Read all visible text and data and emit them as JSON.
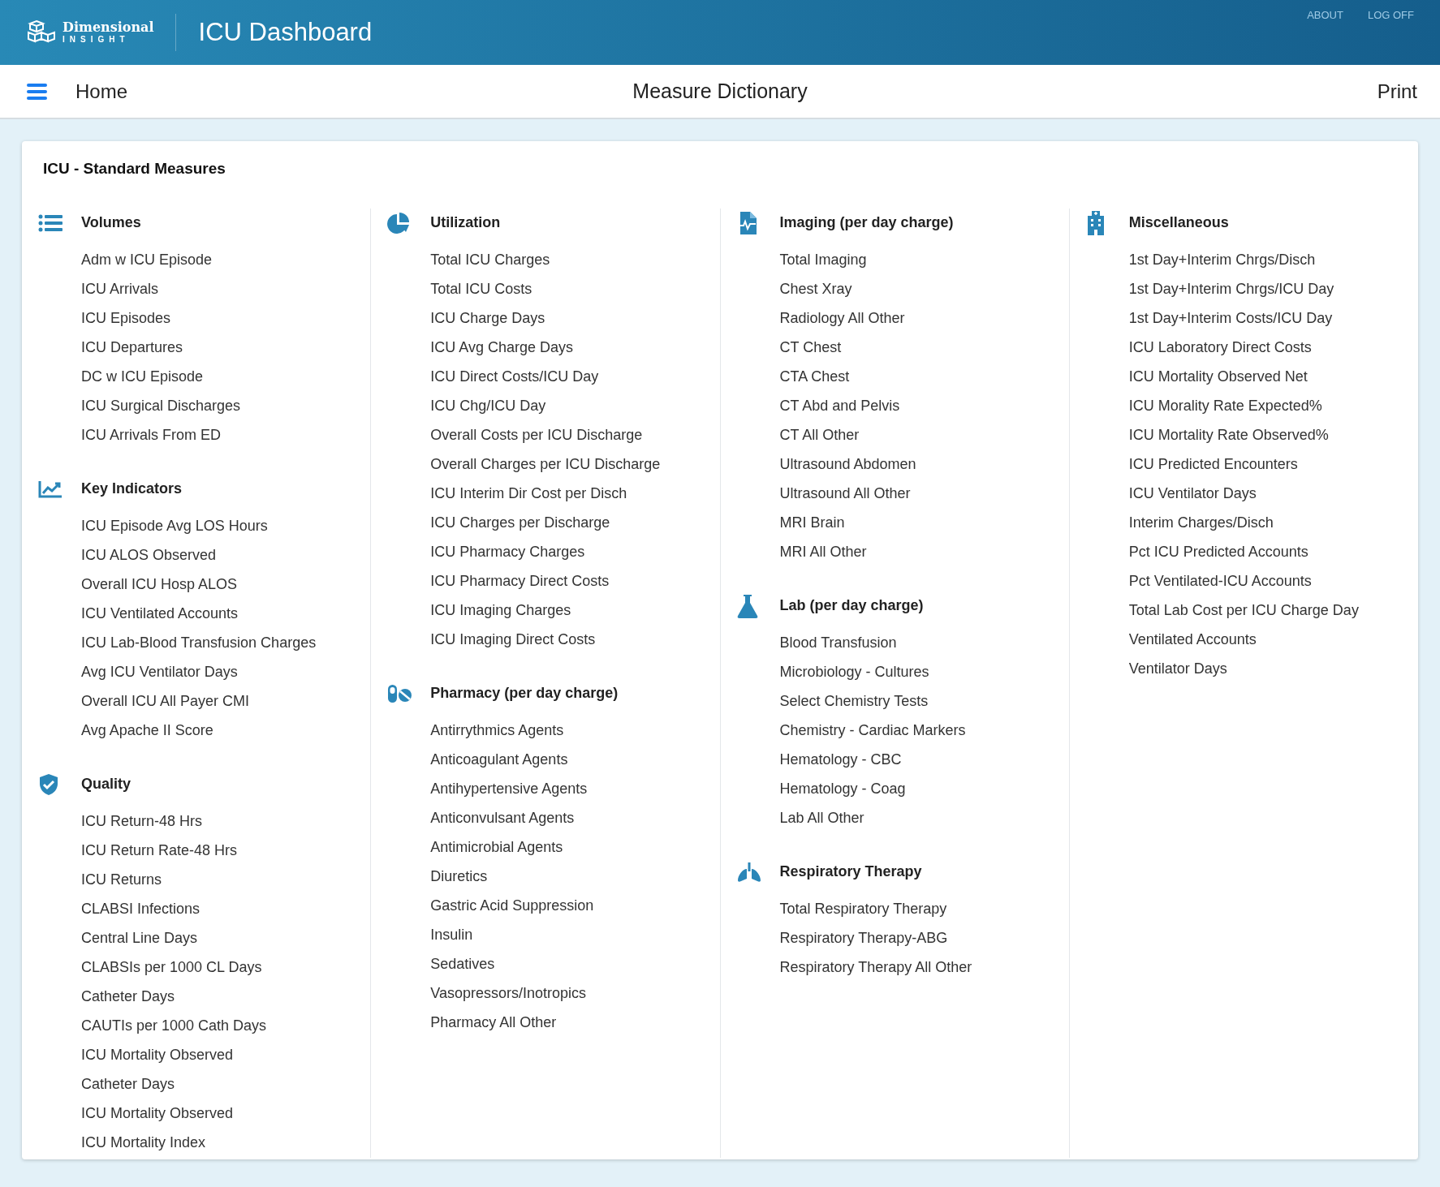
{
  "header": {
    "logo_top": "Dimensional",
    "logo_bottom": "INSIGHT",
    "title": "ICU Dashboard",
    "links": [
      "ABOUT",
      "LOG OFF"
    ]
  },
  "nav": {
    "home": "Home",
    "title": "Measure Dictionary",
    "print": "Print"
  },
  "card": {
    "title": "ICU - Standard Measures",
    "columns": [
      [
        {
          "kind": "list",
          "title": "Volumes",
          "items": [
            "Adm w ICU Episode",
            "ICU Arrivals",
            "ICU Episodes",
            "ICU Departures",
            "DC w ICU Episode",
            "ICU Surgical Discharges",
            "ICU Arrivals From ED"
          ]
        },
        {
          "kind": "chart",
          "title": "Key Indicators",
          "items": [
            "ICU Episode Avg LOS Hours",
            "ICU ALOS Observed",
            "Overall ICU Hosp ALOS",
            "ICU Ventilated Accounts",
            "ICU Lab-Blood Transfusion Charges",
            "Avg ICU Ventilator Days",
            "Overall ICU All Payer CMI",
            "Avg Apache II Score"
          ]
        },
        {
          "kind": "shield",
          "title": "Quality",
          "items": [
            "ICU Return-48 Hrs",
            "ICU Return Rate-48 Hrs",
            "ICU Returns",
            "CLABSI Infections",
            "Central Line Days",
            "CLABSIs per 1000 CL Days",
            "Catheter Days",
            "CAUTIs per 1000 Cath Days",
            "ICU Mortality Observed",
            "Catheter Days",
            "ICU Mortality Observed",
            "ICU Mortality Index"
          ]
        }
      ],
      [
        {
          "kind": "pie",
          "title": "Utilization",
          "items": [
            "Total ICU Charges",
            "Total ICU Costs",
            "ICU Charge Days",
            "ICU Avg Charge Days",
            "ICU Direct Costs/ICU Day",
            "ICU Chg/ICU Day",
            "Overall Costs per ICU Discharge",
            "Overall Charges per ICU Discharge",
            "ICU Interim Dir Cost per Disch",
            "ICU Charges per Discharge",
            "ICU Pharmacy Charges",
            "ICU Pharmacy Direct Costs",
            "ICU Imaging Charges",
            "ICU Imaging Direct Costs"
          ]
        },
        {
          "kind": "pills",
          "title": "Pharmacy (per day charge)",
          "items": [
            "Antirrythmics Agents",
            "Anticoagulant Agents",
            "Antihypertensive Agents",
            "Anticonvulsant Agents",
            "Antimicrobial Agents",
            "Diuretics",
            "Gastric Acid Suppression",
            "Insulin",
            "Sedatives",
            "Vasopressors/Inotropics",
            "Pharmacy All Other"
          ]
        }
      ],
      [
        {
          "kind": "file",
          "title": "Imaging (per day charge)",
          "items": [
            "Total Imaging",
            "Chest Xray",
            "Radiology All Other",
            "CT Chest",
            "CTA Chest",
            "CT Abd and Pelvis",
            "CT All Other",
            "Ultrasound Abdomen",
            "Ultrasound All Other",
            "MRI Brain",
            "MRI All Other"
          ]
        },
        {
          "kind": "flask",
          "title": "Lab (per day charge)",
          "items": [
            "Blood Transfusion",
            "Microbiology - Cultures",
            "Select Chemistry Tests",
            "Chemistry - Cardiac Markers",
            "Hematology - CBC",
            "Hematology - Coag",
            "Lab All Other"
          ]
        },
        {
          "kind": "lungs",
          "title": "Respiratory Therapy",
          "items": [
            "Total Respiratory Therapy",
            "Respiratory Therapy-ABG",
            "Respiratory Therapy All Other"
          ]
        }
      ],
      [
        {
          "kind": "building",
          "title": "Miscellaneous",
          "items": [
            "1st Day+Interim Chrgs/Disch",
            "1st Day+Interim Chrgs/ICU Day",
            "1st Day+Interim Costs/ICU Day",
            "ICU Laboratory Direct Costs",
            "ICU Mortality Observed Net",
            "ICU Morality Rate Expected%",
            "ICU Mortality Rate Observed%",
            "ICU Predicted Encounters",
            "ICU Ventilator Days",
            "Interim Charges/Disch",
            "Pct ICU Predicted Accounts",
            "Pct Ventilated-ICU Accounts",
            "Total Lab Cost per ICU Charge Day",
            "Ventilated Accounts",
            "Ventilator Days"
          ]
        }
      ]
    ]
  }
}
